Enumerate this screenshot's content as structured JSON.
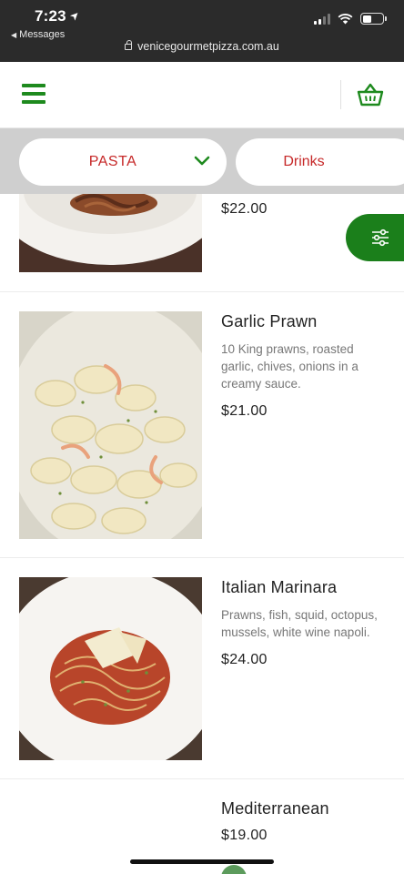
{
  "status_bar": {
    "time": "7:23",
    "back_label": "Messages",
    "url": "venicegourmetpizza.com.au"
  },
  "header": {
    "menu_icon": "hamburger-icon",
    "cart_icon": "basket-icon",
    "brand_color": "#1e8a1e"
  },
  "categories": {
    "active_label": "PASTA",
    "next_label": "Drinks",
    "accent_color": "#c62828"
  },
  "filter_button": {
    "icon": "sliders-icon",
    "color": "#1b7f1b"
  },
  "items": [
    {
      "name": "",
      "description": "",
      "price": "$22.00"
    },
    {
      "name": "Garlic Prawn",
      "description": "10 King prawns, roasted garlic, chives, onions in a creamy sauce.",
      "price": "$21.00"
    },
    {
      "name": "Italian Marinara",
      "description": "Prawns, fish, squid, octopus, mussels, white wine napoli.",
      "price": "$24.00"
    },
    {
      "name": "Mediterranean",
      "description": "",
      "price": "$19.00"
    }
  ]
}
